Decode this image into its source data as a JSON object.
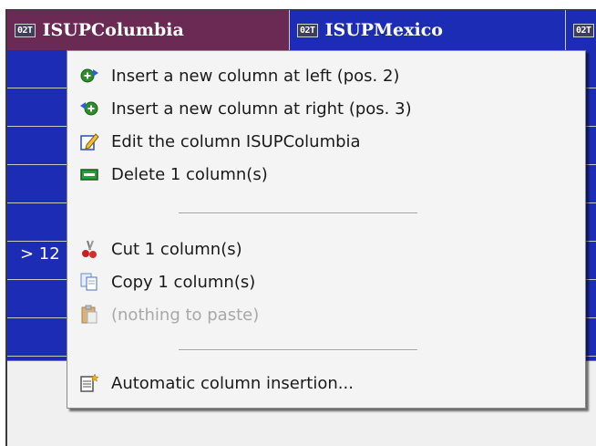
{
  "header": {
    "columns": [
      {
        "badge": "02T",
        "name": "ISUPColumbia",
        "selected": true
      },
      {
        "badge": "02T",
        "name": "ISUPMexico",
        "selected": false
      },
      {
        "badge": "02T",
        "name": "",
        "selected": false
      }
    ]
  },
  "grid": {
    "row_label": "> 12"
  },
  "context_menu": {
    "items": [
      {
        "label": "Insert a new column at left (pos. 2)",
        "icon": "insert-column-left-icon",
        "enabled": true
      },
      {
        "label": "Insert a new column at right (pos. 3)",
        "icon": "insert-column-right-icon",
        "enabled": true
      },
      {
        "label": "Edit the column ISUPColumbia",
        "icon": "edit-icon",
        "enabled": true
      },
      {
        "label": "Delete 1 column(s)",
        "icon": "delete-column-icon",
        "enabled": true
      },
      {
        "label": "Cut 1 column(s)",
        "icon": "scissors-icon",
        "enabled": true
      },
      {
        "label": "Copy 1 column(s)",
        "icon": "copy-icon",
        "enabled": true
      },
      {
        "label": "(nothing to paste)",
        "icon": "paste-icon",
        "enabled": false
      },
      {
        "label": "Automatic column insertion...",
        "icon": "auto-insert-icon",
        "enabled": true
      }
    ]
  },
  "colors": {
    "header_bg": "#1c2cb4",
    "selected_header_bg": "#6a2a54",
    "menu_bg": "#f4f4f4"
  }
}
